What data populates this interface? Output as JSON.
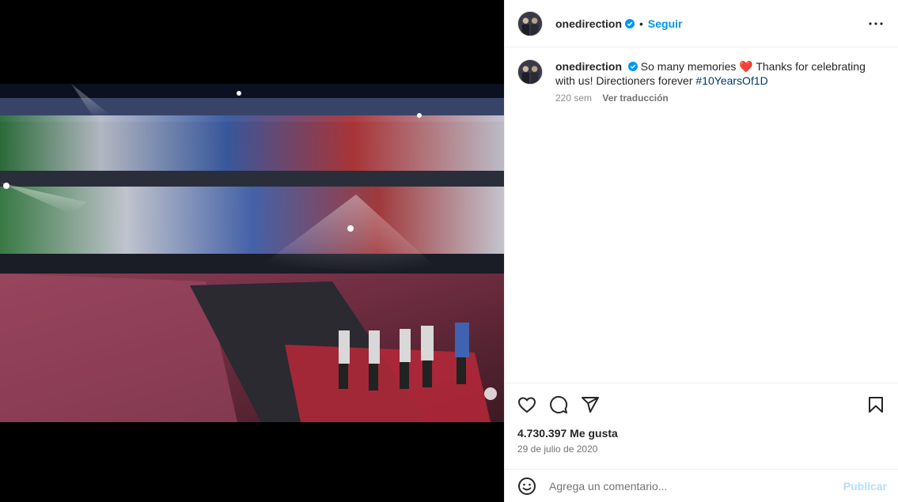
{
  "post": {
    "username": "onedirection",
    "follow_label": "Seguir",
    "separator": "•",
    "more_options_icon": "more-horizontal-icon",
    "caption_text": "So many memories ❤️ Thanks for celebrating with us! Directioners forever ",
    "hashtag": "#10YearsOf1D",
    "age": "220 sem",
    "translate_label": "Ver traducción",
    "likes": "4.730.397 Me gusta",
    "date": "29 de julio de 2020",
    "comment_placeholder": "Agrega un comentario...",
    "publish_label": "Publicar"
  },
  "icons": {
    "like": "heart-icon",
    "comment": "comment-icon",
    "share": "send-icon",
    "save": "bookmark-icon",
    "emoji": "emoji-icon",
    "verified": "verified-badge-icon"
  },
  "colors": {
    "accent": "#0095f6",
    "hashtag": "#00376b",
    "muted": "#737373",
    "publish_disabled": "#b2dffc",
    "border": "#efefef"
  }
}
